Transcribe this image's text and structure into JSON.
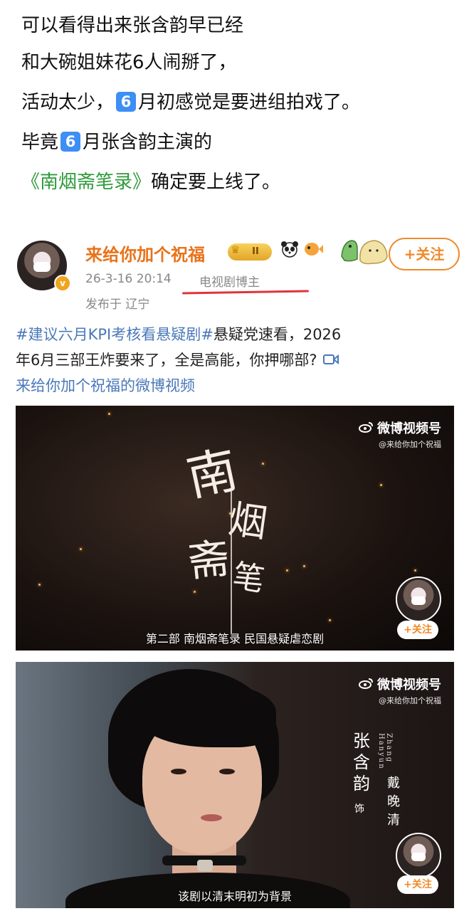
{
  "intro": {
    "line1": "可以看得出来张含韵早已经",
    "line2": "和大碗姐妹花6人闹掰了，",
    "line3_a": "活动太少，",
    "line3_badge": "6",
    "line3_b": "月初感觉是要进组拍戏了。",
    "line4_a": "毕竟",
    "line4_badge": "6",
    "line4_b": "月张含韵主演的",
    "line5_book": "《南烟斋笔录》",
    "line5_rest": "确定要上线了。"
  },
  "post": {
    "username": "来给你加个祝福",
    "vip_level": "II",
    "time": "26-3-16 20:14",
    "tag": "电视剧博主",
    "location": "发布于 辽宁",
    "follow_label": "+关注",
    "text": {
      "hashtag": "#建议六月KPI考核看悬疑剧#",
      "line1_rest": "悬疑党速看，2026",
      "line2": "年6月三部王炸要来了，全是高能，你押哪部?",
      "line3_link": "来给你加个祝福的微博视频"
    }
  },
  "video1": {
    "watermark_brand": "微博视频号",
    "watermark_sub": "@来给你加个祝福",
    "title_chars": [
      "南",
      "烟",
      "斋",
      "笔"
    ],
    "subtitle": "第二部 南烟斋笔录 民国悬疑虐恋剧",
    "follow_label": "+关注"
  },
  "video2": {
    "watermark_brand": "微博视频号",
    "watermark_sub": "@来给你加个祝福",
    "actor_name": "张含韵",
    "actor_pinyin": "Zhang Hanyun",
    "as_label": "饰",
    "role_name": "戴晚清",
    "subtitle": "该剧以清末明初为背景",
    "follow_label": "+关注"
  },
  "colors": {
    "username": "#e8731a",
    "link": "#4a78b8",
    "book_title": "#2e9b3a",
    "tag_underline": "#e0333b",
    "number_badge": "#3d8ef5"
  },
  "icons": [
    "crown-icon",
    "panda-icon",
    "pufferfish-icon",
    "dinosaur-sticker",
    "verified-icon",
    "video-camera-icon",
    "weibo-eye-icon"
  ]
}
